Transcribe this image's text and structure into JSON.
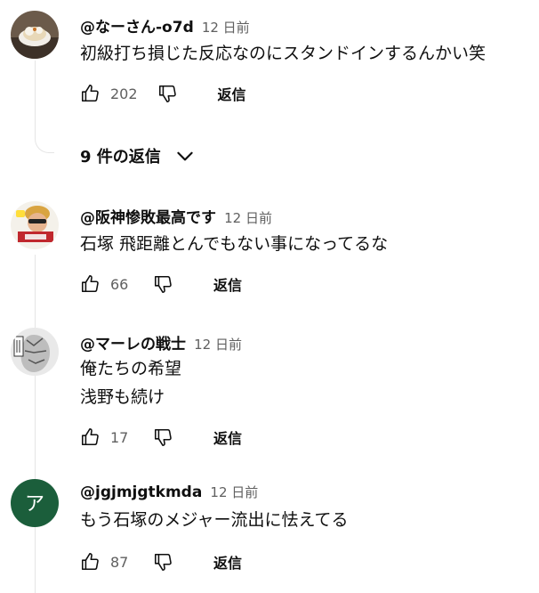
{
  "comments": [
    {
      "author": "@なーさん-o7d",
      "time": "12 日前",
      "lines": [
        "初級打ち損じた反応なのにスタンドインするんかい笑"
      ],
      "likes": "202",
      "reply_label": "返信",
      "avatar_icon": "food-bowl-avatar"
    },
    {
      "author": "@阪神惨敗最高です",
      "time": "12 日前",
      "lines": [
        "石塚 飛距離とんでもない事になってるな"
      ],
      "likes": "66",
      "reply_label": "返信",
      "avatar_icon": "person-avatar"
    },
    {
      "author": "@マーレの戦士",
      "time": "12 日前",
      "lines": [
        "俺たちの希望",
        "浅野も続け"
      ],
      "likes": "17",
      "reply_label": "返信",
      "avatar_icon": "manga-avatar"
    },
    {
      "author": "@jgjmjgtkmda",
      "time": "12 日前",
      "lines": [
        "もう石塚のメジャー流出に怯えてる"
      ],
      "likes": "87",
      "reply_label": "返信",
      "avatar_letter": "ア",
      "avatar_color": "#1b5e3b"
    }
  ],
  "replies_toggle": {
    "label": "9 件の返信"
  }
}
